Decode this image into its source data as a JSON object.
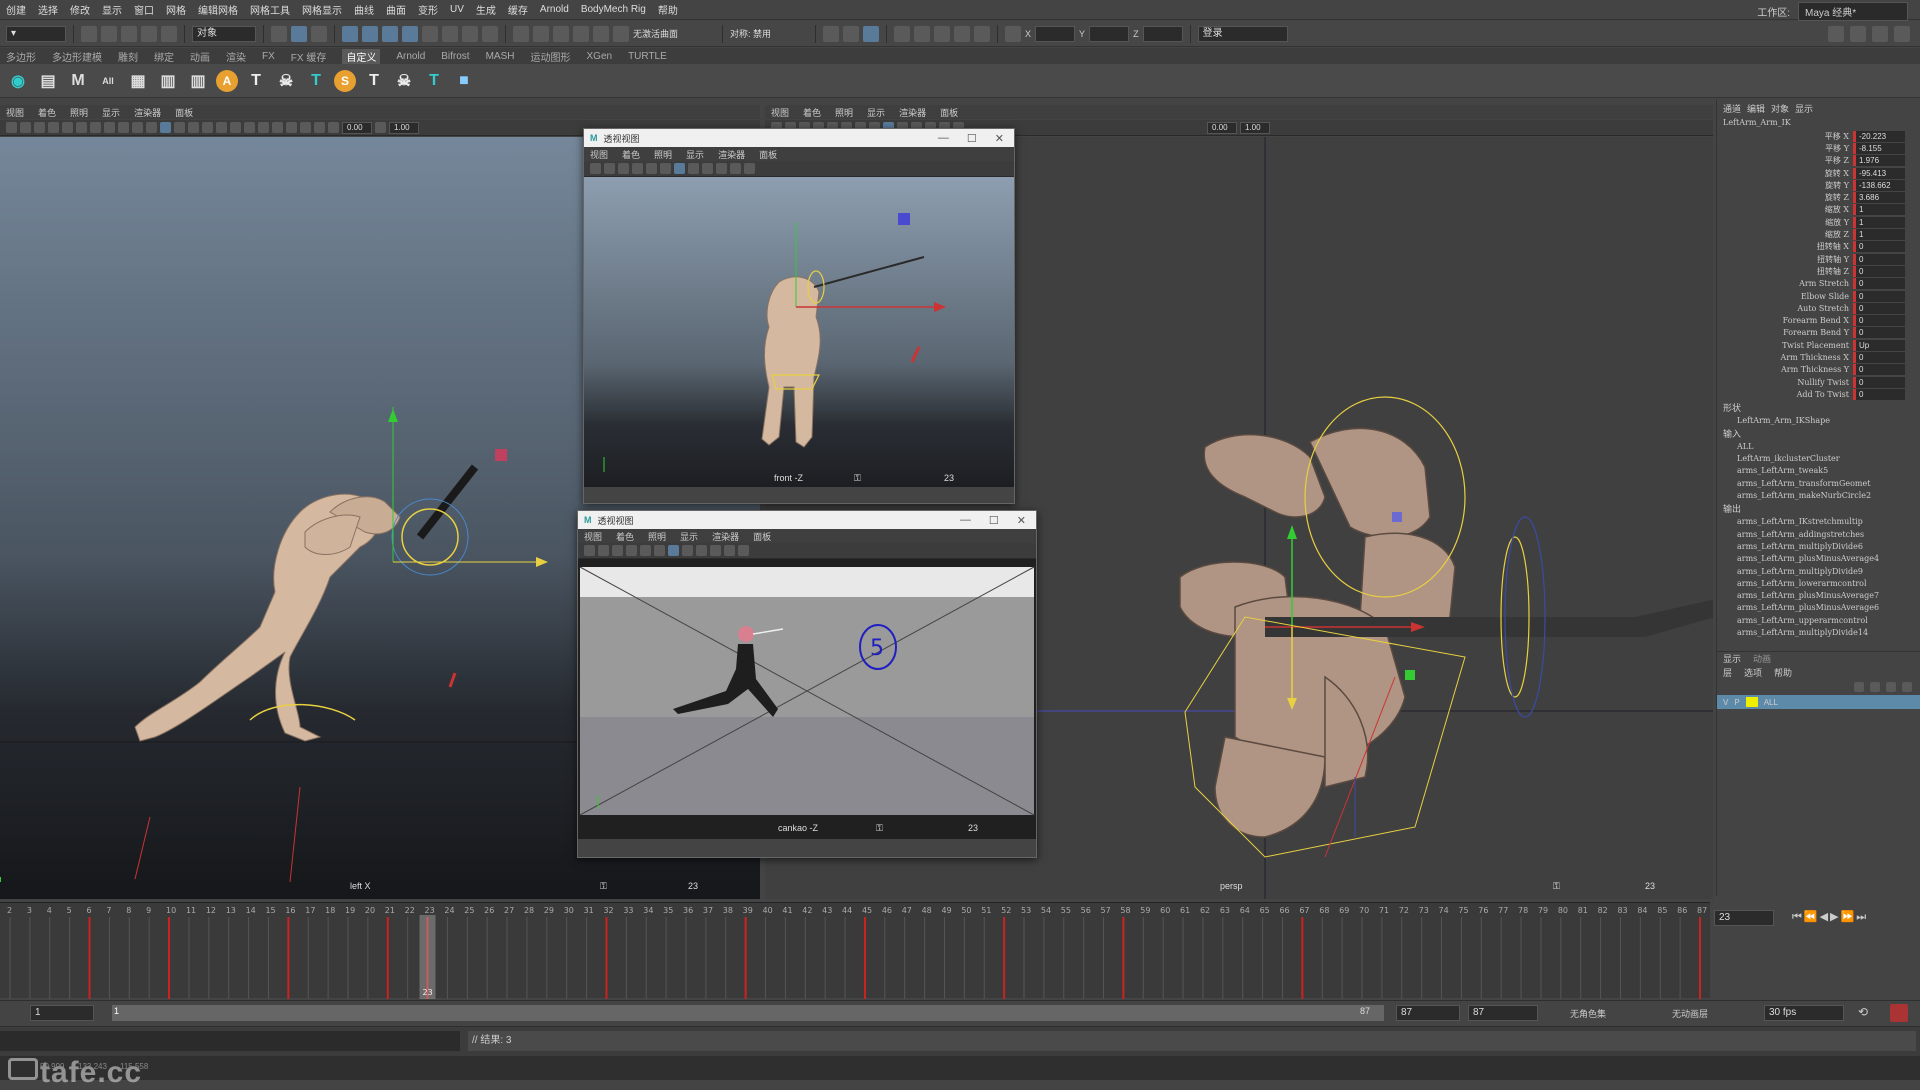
{
  "menubar": {
    "items": [
      "创建",
      "选择",
      "修改",
      "显示",
      "窗口",
      "网格",
      "编辑网格",
      "网格工具",
      "网格显示",
      "曲线",
      "曲面",
      "变形",
      "UV",
      "生成",
      "缓存",
      "Arnold",
      "BodyMech Rig",
      "帮助"
    ],
    "workspace_label": "工作区:",
    "workspace_value": "Maya 经典*"
  },
  "statusline": {
    "mode_value": "对象",
    "render_label": "无激活曲面",
    "symmetry_label": "对称: 禁用",
    "x_label": "X",
    "y_label": "Y",
    "z_label": "Z",
    "login_label": "登录"
  },
  "shelf": {
    "tabs": [
      "多边形",
      "多边形建模",
      "雕刻",
      "绑定",
      "动画",
      "渲染",
      "FX",
      "FX 缓存",
      "自定义",
      "Arnold",
      "Bifrost",
      "MASH",
      "运动图形",
      "XGen",
      "TURTLE"
    ],
    "active_tab": "自定义"
  },
  "left_viewport": {
    "menu": [
      "视图",
      "着色",
      "照明",
      "显示",
      "渲染器",
      "面板"
    ],
    "field1": "0.00",
    "field2": "1.00",
    "camera_label": "left X",
    "frame": "23"
  },
  "right_viewport": {
    "menu": [
      "视图",
      "着色",
      "照明",
      "显示",
      "渲染器",
      "面板"
    ],
    "field1": "0.00",
    "field2": "1.00",
    "camera_label": "persp",
    "frame": "23"
  },
  "float1": {
    "title": "透视视图",
    "menu": [
      "视图",
      "着色",
      "照明",
      "显示",
      "渲染器",
      "面板"
    ],
    "camera_label": "front -Z",
    "frame": "23"
  },
  "float2": {
    "title": "透视视图",
    "menu": [
      "视图",
      "着色",
      "照明",
      "显示",
      "渲染器",
      "面板"
    ],
    "camera_label": "cankao -Z",
    "frame": "23",
    "annotation": "5"
  },
  "channelbox": {
    "tabs": [
      "通道",
      "编辑",
      "对象",
      "显示"
    ],
    "object_name": "LeftArm_Arm_IK",
    "channels": [
      {
        "label": "平移 X",
        "value": "-20.223",
        "keyed": true
      },
      {
        "label": "平移 Y",
        "value": "-8.155",
        "keyed": true
      },
      {
        "label": "平移 Z",
        "value": "1.976",
        "keyed": true
      },
      {
        "label": "旋转 X",
        "value": "-95.413",
        "keyed": true
      },
      {
        "label": "旋转 Y",
        "value": "-138.662",
        "keyed": true
      },
      {
        "label": "旋转 Z",
        "value": "3.686",
        "keyed": true
      },
      {
        "label": "缩放 X",
        "value": "1",
        "keyed": true
      },
      {
        "label": "缩放 Y",
        "value": "1",
        "keyed": true
      },
      {
        "label": "缩放 Z",
        "value": "1",
        "keyed": true
      },
      {
        "label": "扭转轴 X",
        "value": "0",
        "keyed": true
      },
      {
        "label": "扭转轴 Y",
        "value": "0",
        "keyed": true
      },
      {
        "label": "扭转轴 Z",
        "value": "0",
        "keyed": true
      },
      {
        "label": "Arm Stretch",
        "value": "0",
        "keyed": true
      },
      {
        "label": "Elbow Slide",
        "value": "0",
        "keyed": true
      },
      {
        "label": "Auto Stretch",
        "value": "0",
        "keyed": true
      },
      {
        "label": "Forearm Bend X",
        "value": "0",
        "keyed": true
      },
      {
        "label": "Forearm Bend Y",
        "value": "0",
        "keyed": true
      },
      {
        "label": "Twist Placement",
        "value": "Up",
        "keyed": true
      },
      {
        "label": "Arm Thickness X",
        "value": "0",
        "keyed": true
      },
      {
        "label": "Arm Thickness Y",
        "value": "0",
        "keyed": true
      },
      {
        "label": "Nullify Twist",
        "value": "0",
        "keyed": true
      },
      {
        "label": "Add To Twist",
        "value": "0",
        "keyed": true
      }
    ],
    "shapes_header": "形状",
    "shape_name": "LeftArm_Arm_IKShape",
    "inputs_header": "输入",
    "inputs": [
      "ALL",
      "LeftArm_ikclusterCluster",
      "arms_LeftArm_tweak5",
      "arms_LeftArm_transformGeomet",
      "arms_LeftArm_makeNurbCircle2"
    ],
    "outputs_header": "输出",
    "outputs": [
      "arms_LeftArm_IKstretchmultip",
      "arms_LeftArm_addingstretches",
      "arms_LeftArm_multiplyDivide6",
      "arms_LeftArm_plusMinusAverage4",
      "arms_LeftArm_multiplyDivide9",
      "arms_LeftArm_lowerarmcontrol",
      "arms_LeftArm_plusMinusAverage7",
      "arms_LeftArm_plusMinusAverage6",
      "arms_LeftArm_upperarmcontrol",
      "arms_LeftArm_multiplyDivide14"
    ],
    "layer_tabs": [
      "显示",
      "动画"
    ],
    "layer_menu": [
      "层",
      "选项",
      "帮助"
    ],
    "layer_name": "ALL",
    "layer_v": "V",
    "layer_p": "P"
  },
  "timeline": {
    "tick_labels": [
      "2",
      "3",
      "4",
      "5",
      "6",
      "7",
      "8",
      "9",
      "10",
      "11",
      "12",
      "13",
      "14",
      "15",
      "16",
      "17",
      "18",
      "19",
      "20",
      "21",
      "22",
      "23",
      "24",
      "25",
      "26",
      "27",
      "28",
      "29",
      "30",
      "31",
      "32",
      "33",
      "34",
      "35",
      "36",
      "37",
      "38",
      "39",
      "40",
      "41",
      "42",
      "43",
      "44",
      "45",
      "46",
      "47",
      "48",
      "49",
      "50",
      "51",
      "52",
      "53",
      "54",
      "55",
      "56",
      "57",
      "58",
      "59",
      "60",
      "61",
      "62",
      "63",
      "64",
      "65",
      "66",
      "67",
      "68",
      "69",
      "70",
      "71",
      "72",
      "73",
      "74",
      "75",
      "76",
      "77",
      "78",
      "79",
      "80",
      "81",
      "82",
      "83",
      "84",
      "85",
      "86",
      "87"
    ],
    "current_frame": "23",
    "current_field": "23",
    "key_frames": [
      6,
      10,
      16,
      21,
      23,
      32,
      39,
      45,
      52,
      58,
      67,
      87
    ]
  },
  "rangebar": {
    "start": "1",
    "inner_start": "1",
    "inner_end": "87",
    "end1": "87",
    "end2": "87",
    "char_set": "无角色集",
    "anim_layer": "无动画层",
    "fps": "30 fps"
  },
  "cmdline": {
    "result": "// 结果: 3"
  },
  "helpline": {
    "watermark": "tafe.cc",
    "stats": [
      "50.999",
      "133.243",
      "115.558"
    ]
  }
}
